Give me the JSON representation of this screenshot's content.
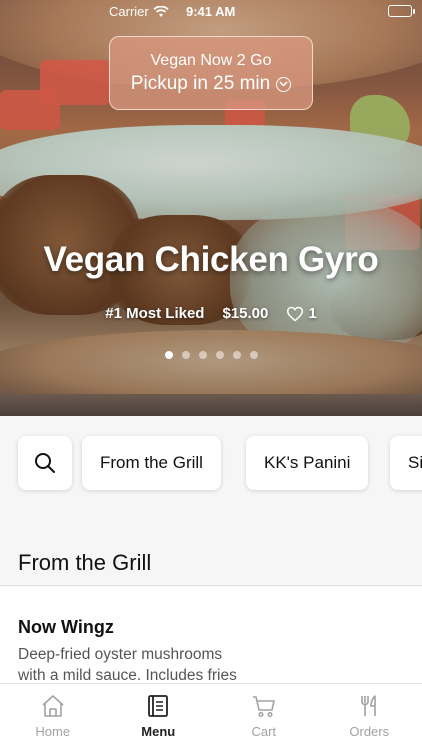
{
  "status_bar": {
    "carrier": "Carrier",
    "time": "9:41 AM"
  },
  "hero": {
    "store_name": "Vegan Now 2 Go",
    "pickup_text": "Pickup in 25 min",
    "dish_name": "Vegan Chicken Gyro",
    "badge": "#1 Most Liked",
    "price": "$15.00",
    "likes": "1",
    "carousel_pages": 6,
    "carousel_active": 1
  },
  "categories": [
    "From the Grill",
    "KK's Panini",
    "Si"
  ],
  "section": {
    "title": "From the Grill"
  },
  "menu_item": {
    "name": "Now Wingz",
    "description": "Deep-fried oyster mushrooms\n with a mild sauce. Includes fries"
  },
  "tabs": [
    {
      "label": "Home",
      "icon": "home-icon",
      "active": false
    },
    {
      "label": "Menu",
      "icon": "menu-book-icon",
      "active": true
    },
    {
      "label": "Cart",
      "icon": "cart-icon",
      "active": false
    },
    {
      "label": "Orders",
      "icon": "fork-knife-icon",
      "active": false
    }
  ],
  "colors": {
    "pickup_pill": "#d6967d",
    "active_tab": "#222222",
    "inactive_tab": "#a2a2a2"
  }
}
